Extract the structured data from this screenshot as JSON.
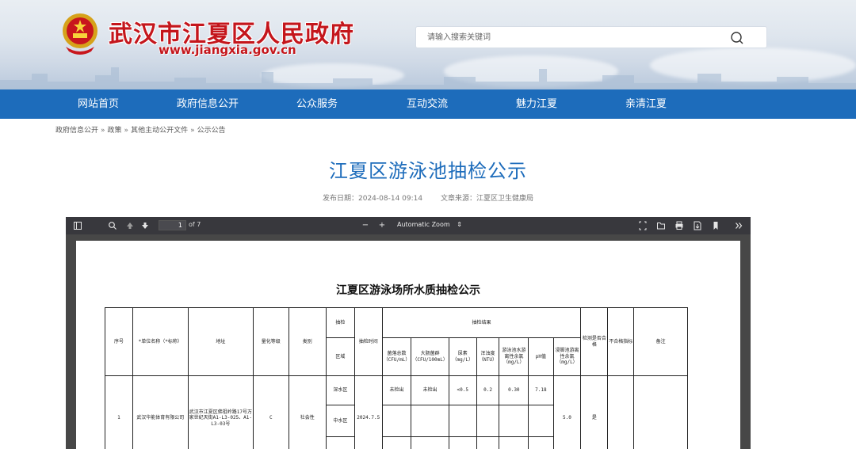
{
  "header": {
    "site_title": "武汉市江夏区人民政府",
    "site_url": "www.jiangxia.gov.cn",
    "emblem_icon": "national-emblem-icon"
  },
  "search": {
    "placeholder": "请输入搜索关键词",
    "icon": "search-icon"
  },
  "nav": {
    "items": [
      "网站首页",
      "政府信息公开",
      "公众服务",
      "互动交流",
      "魅力江夏",
      "亲清江夏"
    ]
  },
  "breadcrumb": {
    "items": [
      "政府信息公开",
      "政策",
      "其他主动公开文件",
      "公示公告"
    ],
    "separator": "»"
  },
  "article": {
    "title": "江夏区游泳池抽检公示",
    "publish_date": "发布日期：2024-08-14 09:14",
    "source": "文章来源：江夏区卫生健康局"
  },
  "pdf_viewer": {
    "page_number": "1",
    "page_count": "of 7",
    "zoom_label": "Automatic Zoom",
    "zoom_minus": "−",
    "zoom_plus": "+"
  },
  "document": {
    "title": "江夏区游泳场所水质抽检公示",
    "headers": {
      "seq": "序号",
      "unit": "*单位名称（*标称）",
      "address": "地址",
      "grade": "量化等级",
      "category": "类别",
      "sample": "抽检",
      "area": "区域",
      "time": "抽检时间",
      "result": "抽检结果",
      "colony": "菌落总数（CFU/mL）",
      "coliform": "大肠菌群（CFU/100mL）",
      "urea": "尿素（mg/L）",
      "turbidity": "浑浊度（NTU）",
      "chlorine": "游泳池水游离性余氯（mg/L）",
      "ph": "pH值",
      "footbath": "浸脚池游离性余氯（mg/L）",
      "qualified": "检测是否合格",
      "unqualified_item": "不合格指标",
      "remark": "备注"
    },
    "row": {
      "seq": "1",
      "unit": "武汉华能体育有限公司",
      "address": "武汉市江夏区佛祖岭路17号万家世纪天街A1-L3-025、A1-L3-03号",
      "grade": "C",
      "category": "社会性",
      "time": "2024.7.5",
      "footbath": "5.0",
      "qualified": "是",
      "areas": [
        {
          "area": "深水区",
          "colony": "未检出",
          "coliform": "未检出",
          "urea": "<0.5",
          "turbidity": "0.2",
          "chlorine": "0.30",
          "ph": "7.18"
        },
        {
          "area": "中水区",
          "colony": "",
          "coliform": "",
          "urea": "",
          "turbidity": "",
          "chlorine": "",
          "ph": ""
        }
      ]
    }
  }
}
